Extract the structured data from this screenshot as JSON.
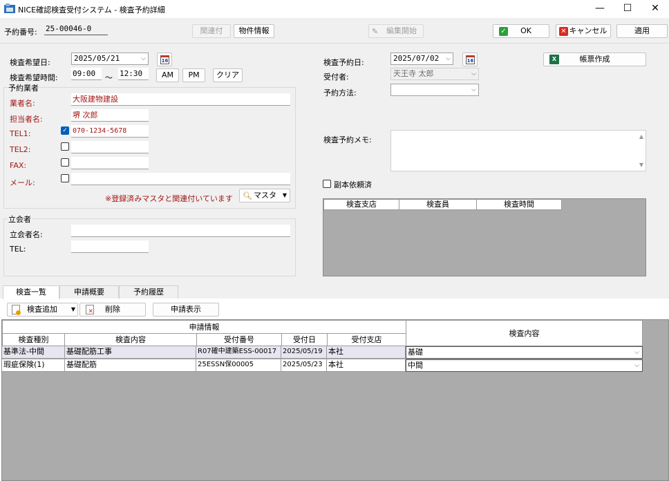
{
  "window": {
    "title": "NICE確認検査受付システム - 検査予約詳細",
    "minimize": "—",
    "maximize": "☐",
    "close": "✕"
  },
  "toolbar": {
    "reservation_no_label": "予約番号:",
    "reservation_no": "25-00046-0",
    "kanren_button": "関連付",
    "bukken_button": "物件情報",
    "edit_start_button": "編集開始",
    "ok_button": "OK",
    "cancel_button": "キャンセル",
    "apply_button": "適用"
  },
  "left": {
    "desired_date_label": "検査希望日:",
    "desired_date": "2025/05/21",
    "desired_time_label": "検査希望時間:",
    "time_from": "09:00",
    "tilde": "～",
    "time_to": "12:30",
    "am_button": "AM",
    "pm_button": "PM",
    "clear_button": "クリア",
    "calendar_glyph": "16"
  },
  "agent": {
    "group_title": "予約業者",
    "company_label": "業者名:",
    "company": "大阪建物建設",
    "person_label": "担当者名:",
    "person": "堺 次郎",
    "tel1_label": "TEL1:",
    "tel1": "070-1234-5678",
    "tel2_label": "TEL2:",
    "tel2": "",
    "fax_label": "FAX:",
    "fax": "",
    "mail_label": "メール:",
    "mail": "",
    "check_mark": "✓",
    "registered_note": "※登録済みマスタと関連付いています",
    "master_button": "マスタ"
  },
  "witness": {
    "group_title": "立会者",
    "name_label": "立会者名:",
    "name": "",
    "tel_label": "TEL:",
    "tel": ""
  },
  "right": {
    "reserve_date_label": "検査予約日:",
    "reserve_date": "2025/07/02",
    "receiver_label": "受付者:",
    "receiver": "天王寺 太郎",
    "method_label": "予約方法:",
    "method": "",
    "report_button": "帳票作成",
    "memo_label": "検査予約メモ:",
    "memo": "",
    "copy_request_label": "副本依頼済",
    "inspection_columns": [
      "検査支店",
      "検査員",
      "検査時間"
    ]
  },
  "tabs": [
    "検査一覧",
    "申請概要",
    "予約履歴"
  ],
  "list_toolbar": {
    "add_button": "検査追加",
    "delete_button": "削除",
    "show_app_button": "申請表示"
  },
  "table": {
    "group_header": "申請情報",
    "right_header": "検査内容",
    "columns": [
      "検査種別",
      "検査内容",
      "受付番号",
      "受付日",
      "受付支店"
    ],
    "rows": [
      {
        "type": "基準法-中間",
        "content": "基礎配筋工事",
        "number": "R07確中建築ESS-00017",
        "date": "2025/05/19",
        "branch": "本社",
        "inspection": "基礎"
      },
      {
        "type": "瑕疵保険(1)",
        "content": "基礎配筋",
        "number": "25ESSN保00005",
        "date": "2025/05/23",
        "branch": "本社",
        "inspection": "中間"
      }
    ]
  },
  "colors": {
    "accent_red": "#a31515",
    "grid_grey": "#ababab",
    "check_blue": "#005fb8"
  },
  "icons": [
    "app-icon",
    "calendar-icon",
    "ok-check-icon",
    "cancel-x-icon",
    "excel-icon",
    "edit-pencil-icon",
    "master-search-icon",
    "add-icon",
    "delete-icon",
    "dropdown-arrow-icon"
  ]
}
